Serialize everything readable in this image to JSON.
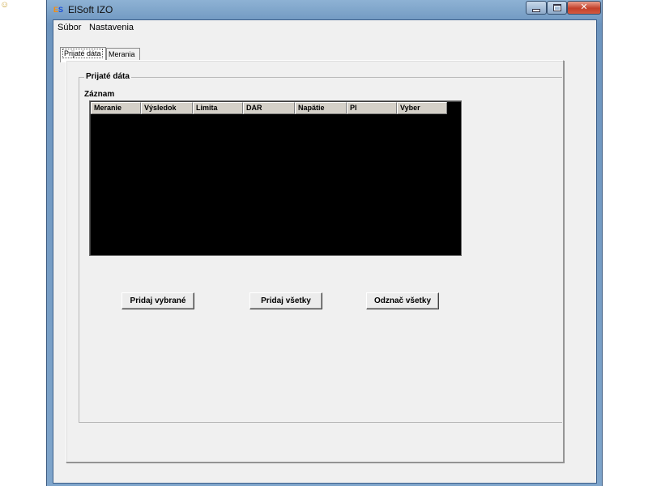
{
  "desktop": {
    "icon": "smiley-icon"
  },
  "window": {
    "title": "ElSoft IZO",
    "app_icon_e": "E",
    "app_icon_s": "S",
    "controls": {
      "minimize": "minimize-icon",
      "maximize": "maximize-icon",
      "close": "✕"
    }
  },
  "menu": {
    "items": [
      "Súbor",
      "Nastavenia"
    ]
  },
  "tabs": [
    {
      "label": "Prijaté dáta",
      "active": true
    },
    {
      "label": "Merania",
      "active": false
    }
  ],
  "group": {
    "title": "Prijaté dáta",
    "record_label": "Záznam"
  },
  "table": {
    "columns": [
      "Meranie",
      "Výsledok",
      "Limita",
      "DAR",
      "Napätie",
      "PI",
      "Vyber"
    ],
    "rows": []
  },
  "buttons": {
    "add_selected": "Pridaj vybrané",
    "add_all": "Pridaj všetky",
    "deselect_all": "Odznač všetky"
  },
  "colors": {
    "list_background": "#000000",
    "window_frame": "#7fa5cb",
    "close_button": "#c3402a"
  }
}
